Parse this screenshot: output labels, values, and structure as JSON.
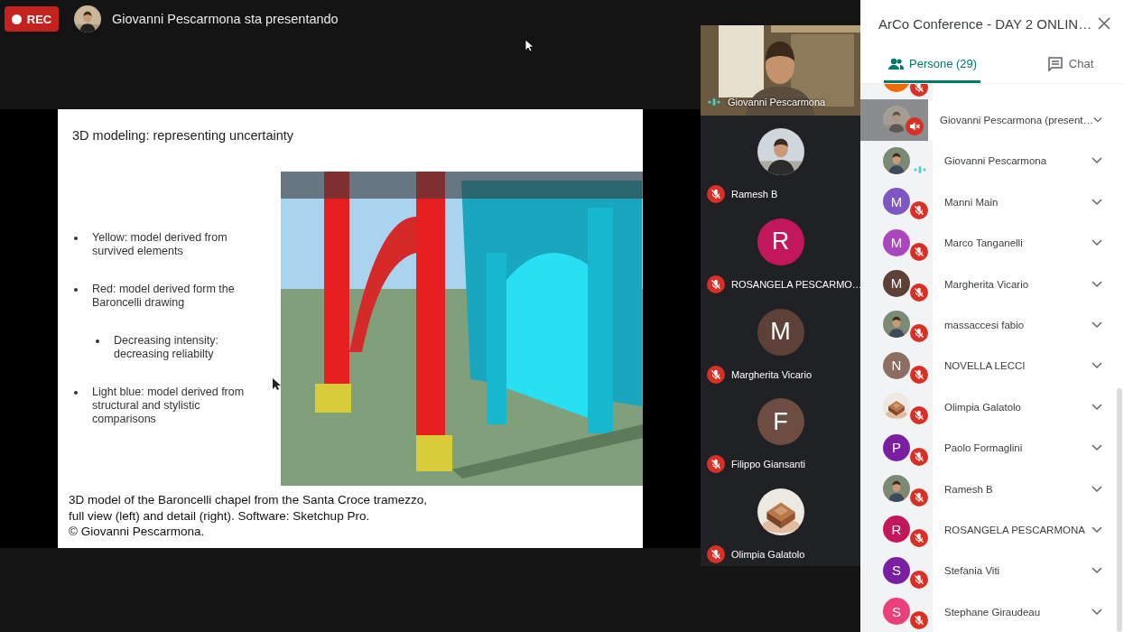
{
  "recording": {
    "label": "REC"
  },
  "presenter_banner": {
    "text": "Giovanni Pescarmona sta presentando"
  },
  "slide": {
    "title": "3D modeling: representing uncertainty",
    "bullets": [
      {
        "lines": [
          "Yellow: model derived from",
          "survived elements"
        ]
      },
      {
        "lines": [
          "Red: model derived form the",
          "Baroncelli drawing"
        ],
        "children": [
          {
            "lines": [
              "Decreasing intensity:",
              "decreasing reliabilty"
            ]
          }
        ]
      },
      {
        "lines": [
          "Light blue: model derived from",
          "structural and stylistic",
          "comparisons"
        ]
      }
    ],
    "caption_lines": [
      "3D model of the Baroncelli chapel from the Santa Croce tramezzo,",
      "full view (left) and detail (right). Software: Sketchup Pro.",
      "© Giovanni Pescarmona."
    ]
  },
  "tiles": [
    {
      "kind": "video",
      "name": "Giovanni Pescarmona",
      "muted": false
    },
    {
      "name": "Ramesh B",
      "muted": true
    },
    {
      "kind": "letter",
      "letter": "R",
      "color": "#c2185b",
      "name": "ROSANGELA PESCARMO…",
      "muted": true
    },
    {
      "kind": "letter",
      "letter": "M",
      "color": "#5d4037",
      "name": "Margherita Vicario",
      "muted": true
    },
    {
      "kind": "letter",
      "letter": "F",
      "color": "#6d4c41",
      "name": "Filippo Giansanti",
      "muted": true
    },
    {
      "name": "Olimpia Galatolo",
      "muted": true
    }
  ],
  "panel": {
    "title": "ArCo Conference - DAY 2 ONLIN…",
    "tabs": [
      {
        "kind": "people",
        "label": "Persone (29)",
        "selected": true
      },
      {
        "kind": "chat",
        "label": "Chat",
        "selected": false
      }
    ],
    "participants": [
      {
        "kind": "letter",
        "color": "#ef6c00",
        "muted": true
      },
      {
        "kind": "presentation",
        "name": "Giovanni Pescarmona (present…",
        "muted": true
      },
      {
        "name": "Giovanni Pescarmona",
        "muted": false
      },
      {
        "kind": "letter",
        "letter": "M",
        "color": "#7e57c2",
        "name": "Manni Main",
        "muted": true
      },
      {
        "kind": "letter",
        "letter": "M",
        "color": "#ab47bc",
        "name": "Marco Tanganelli",
        "muted": true
      },
      {
        "kind": "letter",
        "letter": "M",
        "color": "#5d4037",
        "name": "Margherita Vicario",
        "muted": true
      },
      {
        "name": "massaccesi fabio",
        "muted": true
      },
      {
        "kind": "letter",
        "letter": "N",
        "color": "#8d6e63",
        "name": "NOVELLA LECCI",
        "muted": true
      },
      {
        "name": "Olimpia Galatolo",
        "muted": true
      },
      {
        "kind": "letter",
        "letter": "P",
        "color": "#7b1fa2",
        "name": "Paolo Formaglini",
        "muted": true
      },
      {
        "name": "Ramesh B",
        "muted": true
      },
      {
        "kind": "letter",
        "letter": "R",
        "color": "#c2185b",
        "name": "ROSANGELA PESCARMONA",
        "muted": true
      },
      {
        "kind": "letter",
        "letter": "S",
        "color": "#7b1fa2",
        "name": "Stefania Viti",
        "muted": true
      },
      {
        "kind": "letter",
        "letter": "S",
        "color": "#ec407a",
        "name": "Stephane Giraudeau",
        "muted": true
      }
    ]
  }
}
